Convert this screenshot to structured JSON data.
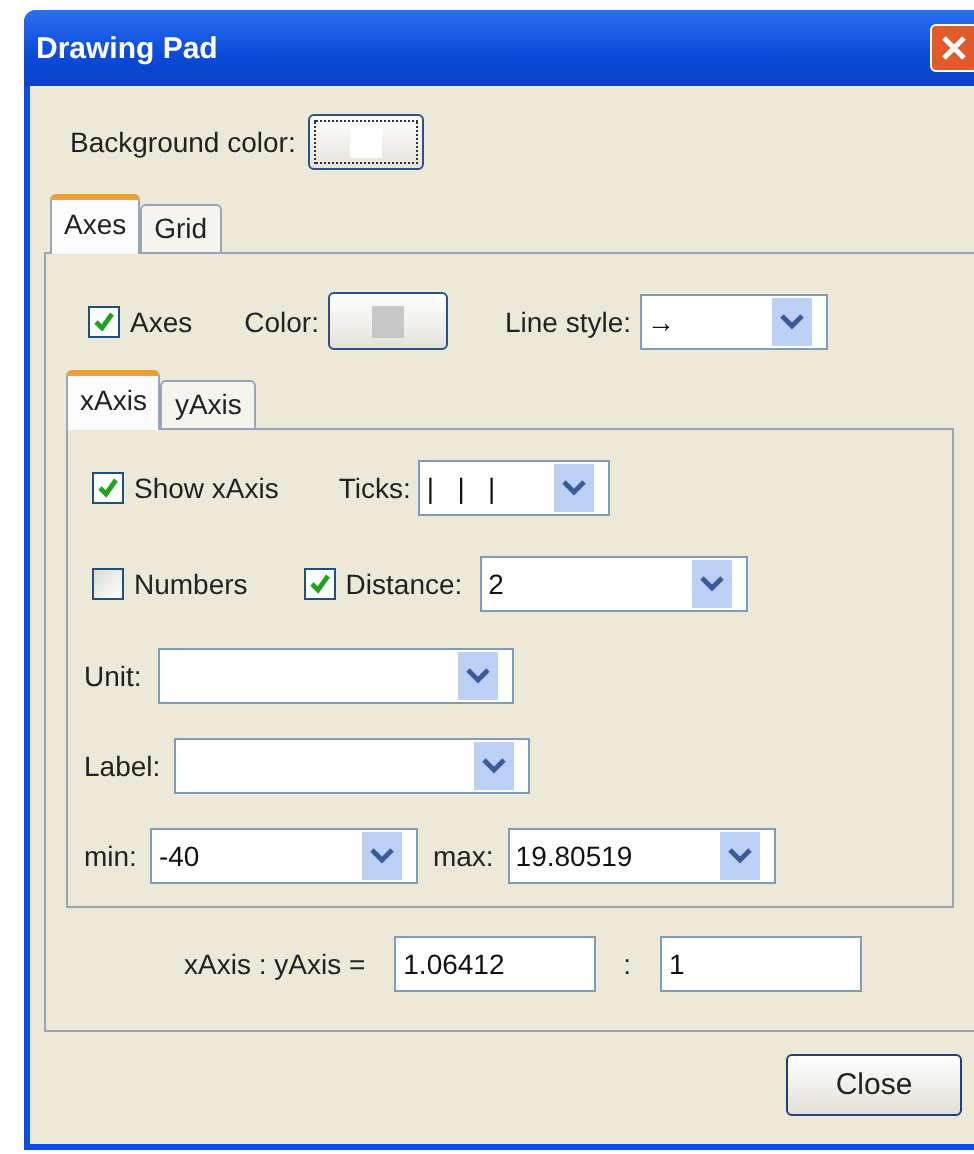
{
  "window": {
    "title": "Drawing Pad"
  },
  "background_color": {
    "label": "Background color:",
    "color": "#ffffff"
  },
  "tabs": [
    {
      "label": "Axes",
      "selected": true
    },
    {
      "label": "Grid",
      "selected": false
    }
  ],
  "axes_row": {
    "axes": {
      "label": "Axes",
      "checked": true
    },
    "color": {
      "label": "Color:",
      "color": "#c8c8c8"
    },
    "line_style": {
      "label": "Line style:",
      "value": "→"
    }
  },
  "axis_tabs": [
    {
      "label": "xAxis",
      "selected": true
    },
    {
      "label": "yAxis",
      "selected": false
    }
  ],
  "axis_panel": {
    "show_axis": {
      "label": "Show xAxis",
      "checked": true
    },
    "ticks": {
      "label": "Ticks:",
      "value": "|   |   |"
    },
    "numbers": {
      "label": "Numbers",
      "checked": false
    },
    "distance": {
      "label": "Distance:",
      "checked": true,
      "value": "2"
    },
    "unit": {
      "label": "Unit:"
    },
    "axis_label": {
      "label": "Label:"
    },
    "min": {
      "label": "min:",
      "value": "-40"
    },
    "max": {
      "label": "max:",
      "value": "19.80519"
    }
  },
  "ratio": {
    "label": "xAxis : yAxis =",
    "x_value": "1.06412",
    "separator": ":",
    "y_value": "1"
  },
  "buttons": [
    "Close"
  ]
}
